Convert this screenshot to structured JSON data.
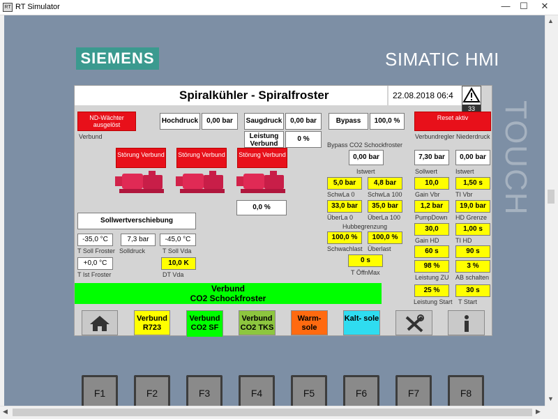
{
  "window": {
    "title": "RT Simulator",
    "minimize": "—",
    "maximize": "☐",
    "close": "✕"
  },
  "device": {
    "brand": "SIEMENS",
    "model": "SIMATIC HMI",
    "touch_label": "TOUCH"
  },
  "header": {
    "title": "Spiralkühler - Spiralfroster",
    "datetime": "22.08.2018 06:4",
    "alarm_count": "33"
  },
  "left": {
    "nd_waechter": "ND-Wächter ausgelöst",
    "verbund_label": "Verbund",
    "hochdruck_label": "Hochdruck",
    "hochdruck_value": "0,00 bar",
    "saugdruck_label": "Saugdruck",
    "saugdruck_value": "0,00 bar",
    "leistung_label": "Leistung Verbund",
    "leistung_value": "0 %",
    "stoerung": [
      "Störung Verbund",
      "Störung Verbund",
      "Störung Verbund"
    ],
    "pump_value": "0,0 %",
    "sollwert_button": "Sollwertverschiebung",
    "t_soll_froster": "-35,0 °C",
    "t_soll_froster_label": "T Soll Froster",
    "solldruck": "7,3 bar",
    "solldruck_label": "Solldruck",
    "t_soll_vda": "-45,0 °C",
    "t_soll_vda_label": "T Soll Vda",
    "t_ist_froster": "+0,0 °C",
    "t_ist_froster_label": "T Ist Froster",
    "dt_vda": "10,0 K",
    "dt_vda_label": "DT Vda"
  },
  "middle": {
    "bypass_label": "Bypass",
    "bypass_value": "100,0 %",
    "bypass_co2_label": "Bypass CO2 Schockfroster",
    "istwert_value": "0,00 bar",
    "istwert_label": "Istwert",
    "schwla0": "5,0 bar",
    "schwla0_label": "SchwLa 0",
    "schwla100": "4,8 bar",
    "schwla100_label": "SchwLa 100",
    "ueberla0": "33,0 bar",
    "ueberla0_label": "ÜberLa 0",
    "ueberla100": "35,0 bar",
    "ueberla100_label": "ÜberLa 100",
    "hubbegrenzung_label": "Hubbegrenzung",
    "schwachlast": "100,0 %",
    "schwachlast_label": "Schwachlast",
    "ueberlast": "100,0 %",
    "ueberlast_label": "Überlast",
    "t_oeffnmax": "0 s",
    "t_oeffnmax_label": "T ÖffnMax"
  },
  "right": {
    "reset_button": "Reset aktiv",
    "verbundregler_label": "Verbundregler Niederdruck",
    "sollwert_value": "7,30 bar",
    "sollwert_label": "Sollwert",
    "istwert_value": "0,00 bar",
    "istwert_label": "Istwert",
    "gain_vbr": "10,0",
    "gain_vbr_label": "Gain Vbr",
    "ti_vbr": "1,50 s",
    "ti_vbr_label": "TI Vbr",
    "pumpdown": "1,2 bar",
    "pumpdown_label": "PumpDown",
    "hd_grenze": "19,0 bar",
    "hd_grenze_label": "HD Grenze",
    "gain_hd": "30,0",
    "gain_hd_label": "Gain HD",
    "ti_hd": "1,00 s",
    "ti_hd_label": "TI HD",
    "t1": "60 s",
    "t2": "90 s",
    "leistung_zu": "98 %",
    "leistung_zu_label": "Leistung ZU",
    "ab_schalten": "3 %",
    "ab_schalten_label": "AB schalten",
    "leistung_start": "25 %",
    "leistung_start_label": "Leistung Start",
    "t_start": "30 s",
    "t_start_label": "T Start"
  },
  "banner": {
    "line1": "Verbund",
    "line2": "CO2 Schockfroster"
  },
  "nav": [
    {
      "label": ""
    },
    {
      "label": "Verbund R723"
    },
    {
      "label": "Verbund CO2 SF"
    },
    {
      "label": "Verbund CO2 TKS"
    },
    {
      "label": "Warm- sole"
    },
    {
      "label": "Kalt- sole"
    }
  ],
  "fkeys": [
    "F1",
    "F2",
    "F3",
    "F4",
    "F5",
    "F6",
    "F7",
    "F8"
  ],
  "colors": {
    "alarm_red": "#e8101a",
    "value_yellow": "#ffff00",
    "banner_green": "#00ff00",
    "siemens_teal": "#3b9a8f"
  }
}
